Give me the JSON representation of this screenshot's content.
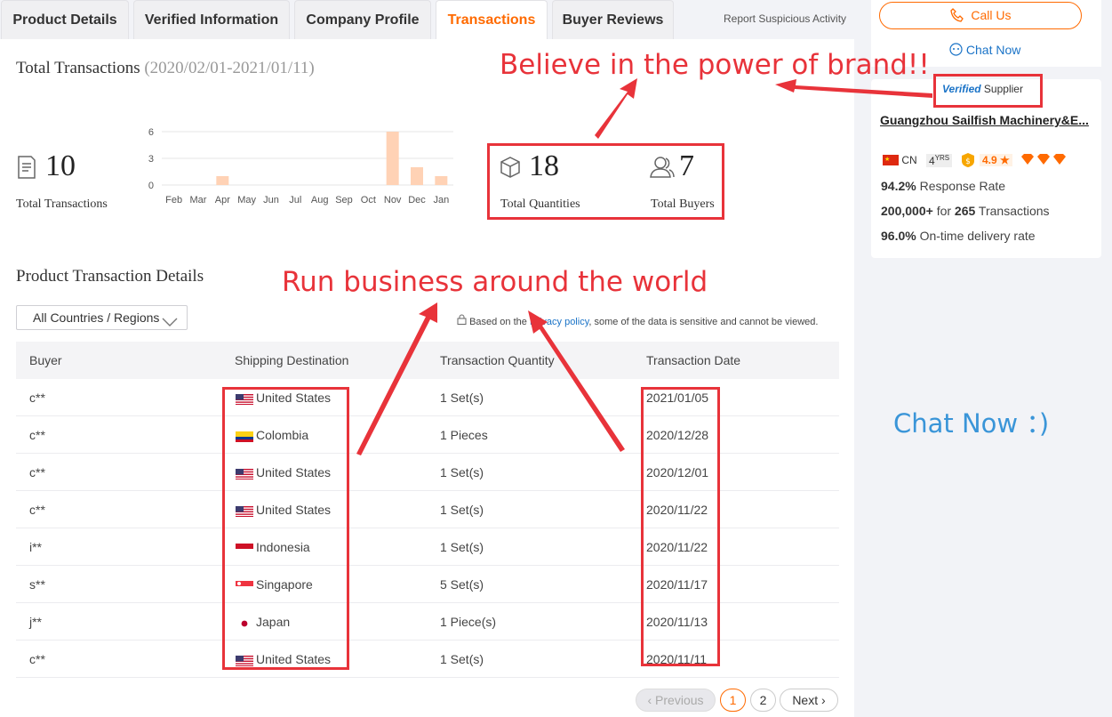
{
  "tabs": [
    {
      "label": "Product Details"
    },
    {
      "label": "Verified Information"
    },
    {
      "label": "Company Profile"
    },
    {
      "label": "Transactions"
    },
    {
      "label": "Buyer Reviews"
    }
  ],
  "report_link": "Report Suspicious Activity",
  "summary": {
    "title": "Total Transactions",
    "range": "(2020/02/01-2021/01/11)",
    "total_transactions": "10",
    "total_transactions_label": "Total Transactions",
    "total_quantities": "18",
    "total_quantities_label": "Total Quantities",
    "total_buyers": "7",
    "total_buyers_label": "Total Buyers"
  },
  "chart_data": {
    "type": "bar",
    "categories": [
      "Feb",
      "Mar",
      "Apr",
      "May",
      "Jun",
      "Jul",
      "Aug",
      "Sep",
      "Oct",
      "Nov",
      "Dec",
      "Jan"
    ],
    "values": [
      0,
      0,
      1,
      0,
      0,
      0,
      0,
      0,
      0,
      6,
      2,
      1
    ],
    "yticks": [
      "6",
      "3",
      "0"
    ],
    "ylim": [
      0,
      6
    ],
    "grid": true,
    "color": "#ffd2b5"
  },
  "details": {
    "title": "Product Transaction Details",
    "filter_value": "All Countries / Regions",
    "privacy_prefix": "Based on the ",
    "privacy_link": "Privacy policy",
    "privacy_suffix": ", some of the data is sensitive and cannot be viewed.",
    "columns": [
      "Buyer",
      "Shipping Destination",
      "Transaction Quantity",
      "Transaction Date"
    ],
    "rows": [
      {
        "buyer": "c**",
        "destination": "United States",
        "flag": "us",
        "quantity": "1 Set(s)",
        "date": "2021/01/05"
      },
      {
        "buyer": "c**",
        "destination": "Colombia",
        "flag": "co",
        "quantity": "1 Pieces",
        "date": "2020/12/28"
      },
      {
        "buyer": "c**",
        "destination": "United States",
        "flag": "us",
        "quantity": "1 Set(s)",
        "date": "2020/12/01"
      },
      {
        "buyer": "c**",
        "destination": "United States",
        "flag": "us",
        "quantity": "1 Set(s)",
        "date": "2020/11/22"
      },
      {
        "buyer": "i**",
        "destination": "Indonesia",
        "flag": "id",
        "quantity": "1 Set(s)",
        "date": "2020/11/22"
      },
      {
        "buyer": "s**",
        "destination": "Singapore",
        "flag": "sg",
        "quantity": "5 Set(s)",
        "date": "2020/11/17"
      },
      {
        "buyer": "j**",
        "destination": "Japan",
        "flag": "jp",
        "quantity": "1 Piece(s)",
        "date": "2020/11/13"
      },
      {
        "buyer": "c**",
        "destination": "United States",
        "flag": "us",
        "quantity": "1 Set(s)",
        "date": "2020/11/11"
      }
    ]
  },
  "pagination": {
    "prev": "Previous",
    "pages": [
      "1",
      "2"
    ],
    "next": "Next"
  },
  "sidebar": {
    "call_us": "Call Us",
    "chat_now": "Chat Now",
    "verified_v": "Verified",
    "verified_supplier": "Supplier",
    "company": "Guangzhou Sailfish Machinery&E...",
    "country": "CN",
    "years_num": "4",
    "years_unit": "YRS",
    "rating": "4.9",
    "response_rate": "94.2%",
    "response_rate_label": "Response Rate",
    "transactions_amount": "200,000+",
    "transactions_for": "for",
    "transactions_count": "265",
    "transactions_label": "Transactions",
    "ontime": "96.0%",
    "ontime_label": "On-time delivery rate"
  },
  "annotations": {
    "brand": "Believe in the power of brand!!",
    "world": "Run business around the world",
    "chat": "Chat Now ：)"
  },
  "colors": {
    "accent": "#ff6a00",
    "link": "#1a73c7",
    "annotation": "#e8333a",
    "annotation_blue": "#3a95d8"
  }
}
